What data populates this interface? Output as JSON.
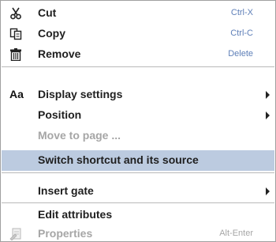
{
  "menu": {
    "items": [
      {
        "label": "Cut",
        "shortcut": "Ctrl-X",
        "icon": "scissors-icon"
      },
      {
        "label": "Copy",
        "shortcut": "Ctrl-C",
        "icon": "copy-icon"
      },
      {
        "label": "Remove",
        "shortcut": "Delete",
        "icon": "trash-icon"
      },
      {
        "label": "Display settings",
        "icon_text": "Aa",
        "has_submenu": true
      },
      {
        "label": "Position",
        "has_submenu": true
      },
      {
        "label": "Move to page ...",
        "enabled": false
      },
      {
        "label": "Switch shortcut and its source",
        "highlighted": true
      },
      {
        "label": "Insert gate",
        "has_submenu": true
      },
      {
        "label": "Edit attributes"
      },
      {
        "label": "Properties",
        "shortcut": "Alt-Enter",
        "enabled": false,
        "icon": "properties-icon"
      }
    ]
  },
  "colors": {
    "highlight": "#bccbe0",
    "shortcut": "#5e7fb8",
    "disabled": "#a6a6a6",
    "separator": "#b9b9b9"
  }
}
